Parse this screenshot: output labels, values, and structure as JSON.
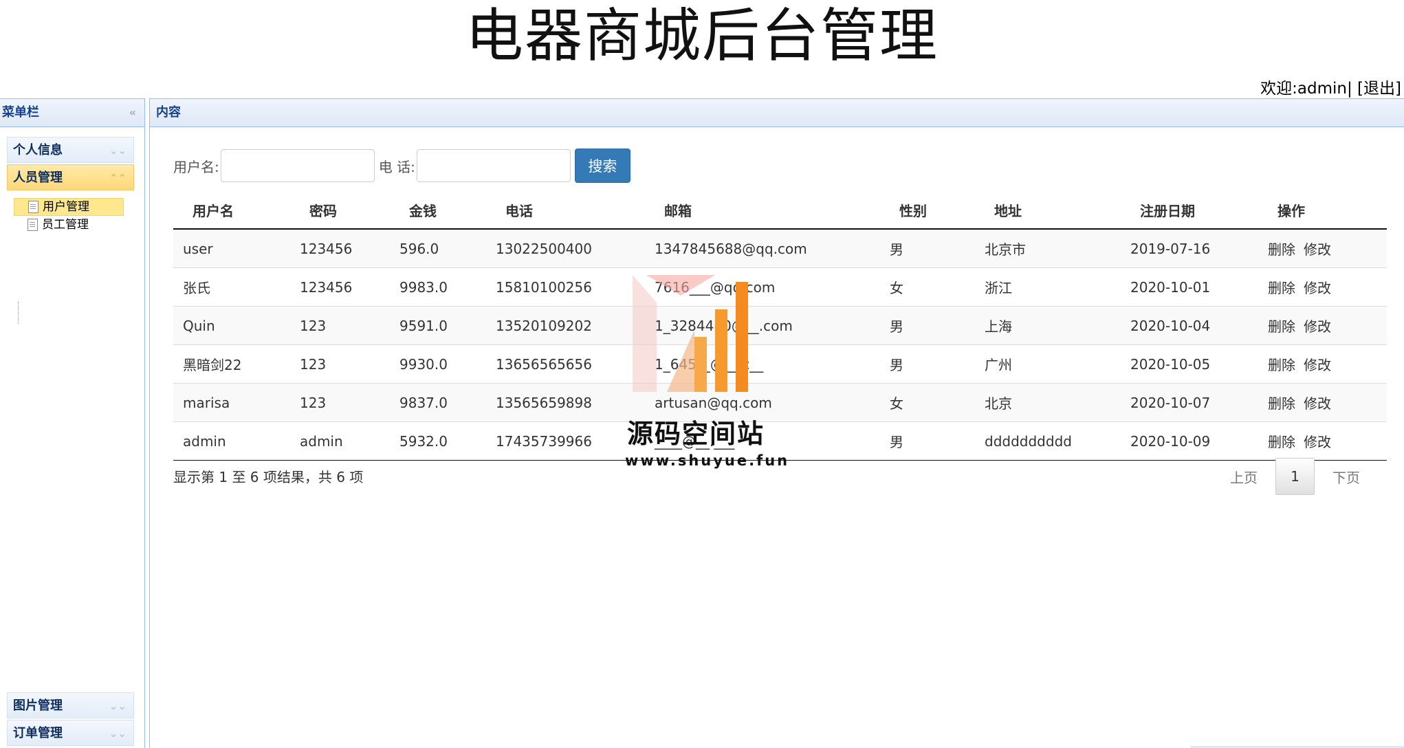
{
  "header": {
    "title": "电器商城后台管理",
    "welcome": "欢迎:admin|",
    "logout": "[退出]"
  },
  "sidebar": {
    "title": "菜单栏",
    "collapse_icon": "«",
    "sections": [
      {
        "label": "个人信息"
      },
      {
        "label": "人员管理"
      },
      {
        "label": "图片管理"
      },
      {
        "label": "订单管理"
      }
    ],
    "items": [
      {
        "label": "用户管理"
      },
      {
        "label": "员工管理"
      }
    ]
  },
  "content": {
    "title": "内容",
    "search": {
      "username_label": "用户名:",
      "username_value": "",
      "phone_label": "电 话:",
      "phone_value": "",
      "button": "搜索"
    },
    "table": {
      "headers": [
        "用户名",
        "密码",
        "金钱",
        "电话",
        "邮箱",
        "性别",
        "地址",
        "注册日期",
        "操作"
      ],
      "rows": [
        [
          "user",
          "123456",
          "596.0",
          "13022500400",
          "1347845688@qq.com",
          "男",
          "北京市",
          "2019-07-16"
        ],
        [
          "张氏",
          "123456",
          "9983.0",
          "15810100256",
          "7616___@qq.com",
          "女",
          "浙江",
          "2020-10-01"
        ],
        [
          "Quin",
          "123",
          "9591.0",
          "13520109202",
          "1_3284480@__.com",
          "男",
          "上海",
          "2020-10-04"
        ],
        [
          "黑暗剑22",
          "123",
          "9930.0",
          "13656565656",
          "1_645__@__.c__",
          "男",
          "广州",
          "2020-10-05"
        ],
        [
          "marisa",
          "123",
          "9837.0",
          "13565659898",
          "artusan@qq.com",
          "女",
          "北京",
          "2020-10-07"
        ],
        [
          "admin",
          "admin",
          "5932.0",
          "17435739966",
          "____@__.___",
          "男",
          "dddddddddd",
          "2020-10-09"
        ]
      ],
      "delete_label": "删除",
      "edit_label": "修改"
    },
    "info": "显示第 1 至 6 项结果，共 6 项",
    "pager": {
      "prev": "上页",
      "current": "1",
      "next": "下页"
    }
  },
  "watermark": {
    "text": "源码空间站",
    "url": "www.shuyue.fun"
  }
}
